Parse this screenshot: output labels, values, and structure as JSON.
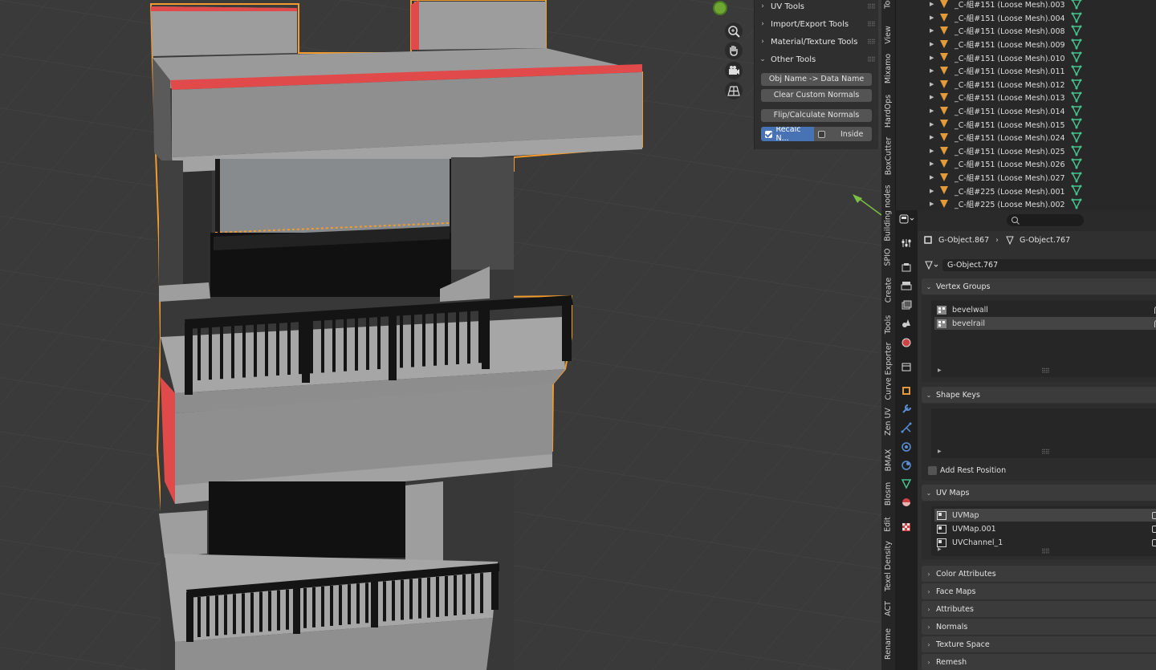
{
  "npanel": {
    "sections": [
      {
        "label": "UV Tools",
        "expanded": false
      },
      {
        "label": "Import/Export Tools",
        "expanded": false
      },
      {
        "label": "Material/Texture Tools",
        "expanded": false
      },
      {
        "label": "Other Tools",
        "expanded": true
      }
    ],
    "buttons": [
      "Obj Name -> Data Name",
      "Clear Custom Normals",
      "Flip/Calculate Normals"
    ],
    "recalc": {
      "label": "Recalc N...",
      "checked": true
    },
    "inside": {
      "label": "Inside",
      "checked": false
    }
  },
  "tabs": [
    "Tool",
    "View",
    "Mixamo",
    "HardOps",
    "BoxCutter",
    "Building nodes",
    "SPIO",
    "Create",
    "Tools",
    "Curve Exporter",
    "Zen UV",
    "BMAX",
    "Blosm",
    "Edit",
    "Texel Density",
    "ACT",
    "Rename"
  ],
  "outliner": {
    "rows": [
      "_C-組#151 (Loose Mesh).003",
      "_C-組#151 (Loose Mesh).004",
      "_C-組#151 (Loose Mesh).008",
      "_C-組#151 (Loose Mesh).009",
      "_C-組#151 (Loose Mesh).010",
      "_C-組#151 (Loose Mesh).011",
      "_C-組#151 (Loose Mesh).012",
      "_C-組#151 (Loose Mesh).013",
      "_C-組#151 (Loose Mesh).014",
      "_C-組#151 (Loose Mesh).015",
      "_C-組#151 (Loose Mesh).024",
      "_C-組#151 (Loose Mesh).025",
      "_C-組#151 (Loose Mesh).026",
      "_C-組#151 (Loose Mesh).027",
      "_C-組#225 (Loose Mesh).001",
      "_C-組#225 (Loose Mesh).002"
    ]
  },
  "props": {
    "breadcrumb": {
      "object": "G-Object.867",
      "mesh": "G-Object.767"
    },
    "mesh_name": "G-Object.767",
    "sections": {
      "vertex_groups": "Vertex Groups",
      "shape_keys": "Shape Keys",
      "add_rest": "Add Rest Position",
      "uv_maps": "UV Maps",
      "color_attributes": "Color Attributes",
      "face_maps": "Face Maps",
      "attributes": "Attributes",
      "normals": "Normals",
      "texture_space": "Texture Space",
      "remesh": "Remesh"
    },
    "vertex_groups": [
      "bevelwall",
      "bevelrail"
    ],
    "uv_maps": [
      "UVMap",
      "UVMap.001",
      "UVChannel_1"
    ]
  },
  "colors": {
    "accent": "#4772b3",
    "selection_outline": "#f29b2f",
    "mesh_icon": "#47c18e",
    "object_icon": "#e39a3b"
  }
}
